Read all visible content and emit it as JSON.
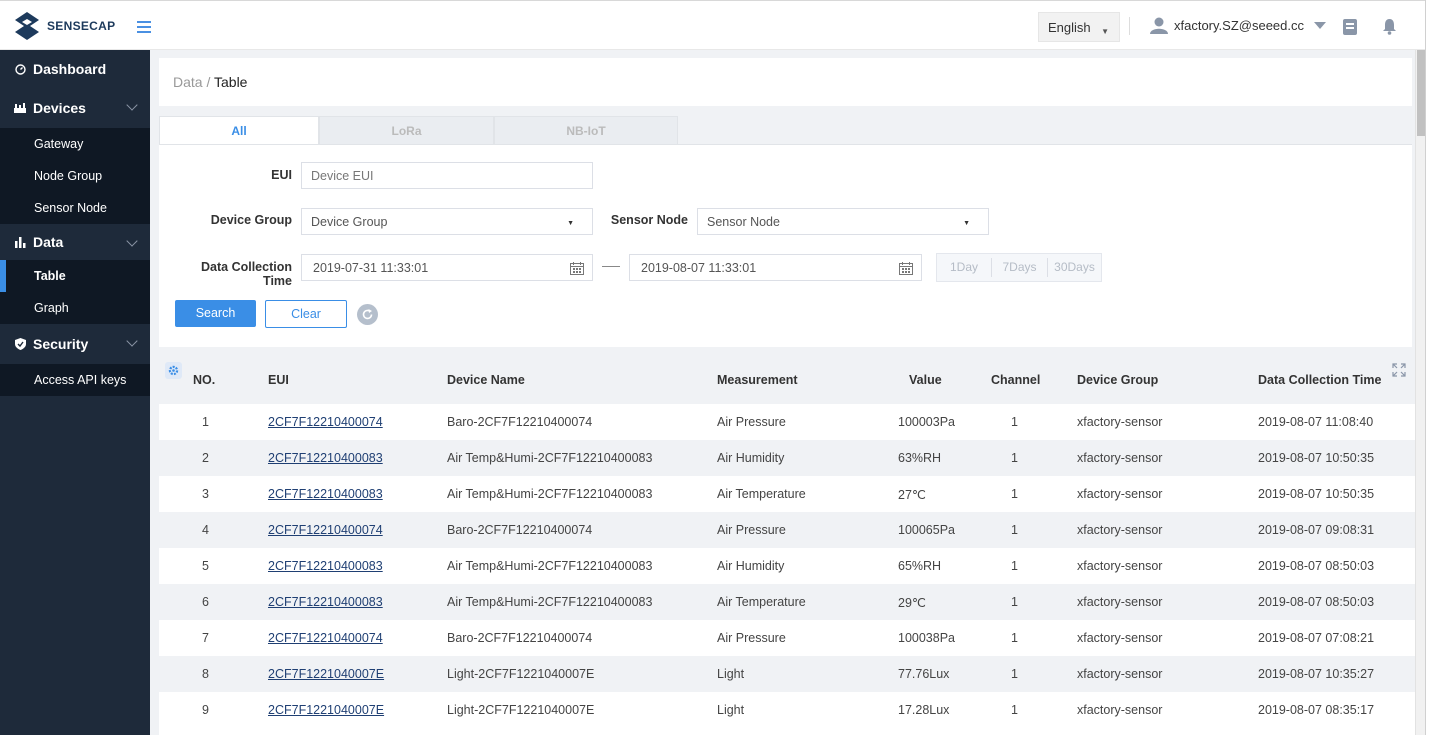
{
  "header": {
    "brand": "SENSECAP",
    "language": "English",
    "user_email": "xfactory.SZ@seeed.cc"
  },
  "sidebar": {
    "items": [
      {
        "label": "Dashboard",
        "icon": "dashboard-icon"
      },
      {
        "label": "Devices",
        "icon": "devices-icon",
        "children": [
          "Gateway",
          "Node Group",
          "Sensor Node"
        ]
      },
      {
        "label": "Data",
        "icon": "bar-chart-icon",
        "children": [
          "Table",
          "Graph"
        ]
      },
      {
        "label": "Security",
        "icon": "shield-icon",
        "children": [
          "Access API keys"
        ]
      }
    ],
    "active": "Table"
  },
  "breadcrumb": {
    "parent": "Data",
    "separator": " / ",
    "current": "Table"
  },
  "tabs": [
    "All",
    "LoRa",
    "NB-IoT"
  ],
  "filters": {
    "eui_label": "EUI",
    "eui_placeholder": "Device EUI",
    "device_group_label": "Device Group",
    "device_group_value": "Device Group",
    "sensor_node_label": "Sensor Node",
    "sensor_node_value": "Sensor Node",
    "time_label": "Data Collection Time",
    "time_start": "2019-07-31 11:33:01",
    "time_end": "2019-08-07 11:33:01",
    "quick": [
      "1Day",
      "7Days",
      "30Days"
    ],
    "search_label": "Search",
    "clear_label": "Clear"
  },
  "table": {
    "columns": [
      "NO.",
      "EUI",
      "Device Name",
      "Measurement",
      "Value",
      "Channel",
      "Device Group",
      "Data Collection Time"
    ],
    "rows": [
      [
        "1",
        "2CF7F12210400074",
        "Baro-2CF7F12210400074",
        "Air Pressure",
        "100003Pa",
        "1",
        "xfactory-sensor",
        "2019-08-07 11:08:40"
      ],
      [
        "2",
        "2CF7F12210400083",
        "Air Temp&Humi-2CF7F12210400083",
        "Air Humidity",
        "63%RH",
        "1",
        "xfactory-sensor",
        "2019-08-07 10:50:35"
      ],
      [
        "3",
        "2CF7F12210400083",
        "Air Temp&Humi-2CF7F12210400083",
        "Air Temperature",
        "27℃",
        "1",
        "xfactory-sensor",
        "2019-08-07 10:50:35"
      ],
      [
        "4",
        "2CF7F12210400074",
        "Baro-2CF7F12210400074",
        "Air Pressure",
        "100065Pa",
        "1",
        "xfactory-sensor",
        "2019-08-07 09:08:31"
      ],
      [
        "5",
        "2CF7F12210400083",
        "Air Temp&Humi-2CF7F12210400083",
        "Air Humidity",
        "65%RH",
        "1",
        "xfactory-sensor",
        "2019-08-07 08:50:03"
      ],
      [
        "6",
        "2CF7F12210400083",
        "Air Temp&Humi-2CF7F12210400083",
        "Air Temperature",
        "29℃",
        "1",
        "xfactory-sensor",
        "2019-08-07 08:50:03"
      ],
      [
        "7",
        "2CF7F12210400074",
        "Baro-2CF7F12210400074",
        "Air Pressure",
        "100038Pa",
        "1",
        "xfactory-sensor",
        "2019-08-07 07:08:21"
      ],
      [
        "8",
        "2CF7F1221040007E",
        "Light-2CF7F1221040007E",
        "Light",
        "77.76Lux",
        "1",
        "xfactory-sensor",
        "2019-08-07 10:35:27"
      ],
      [
        "9",
        "2CF7F1221040007E",
        "Light-2CF7F1221040007E",
        "Light",
        "17.28Lux",
        "1",
        "xfactory-sensor",
        "2019-08-07 08:35:17"
      ]
    ]
  },
  "colors": {
    "accent": "#3a8ee6",
    "sidebar": "#1e2a3a",
    "sidebar_sub": "#0f1824",
    "link": "#1f3f73"
  }
}
